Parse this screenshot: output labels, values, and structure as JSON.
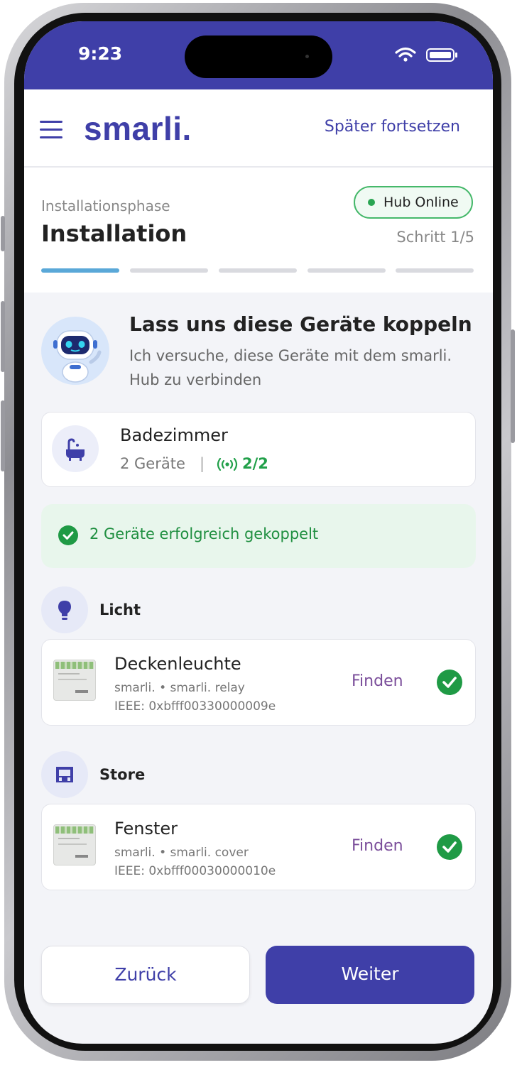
{
  "status_bar": {
    "time": "9:23"
  },
  "header": {
    "logo": "smarli.",
    "later_label": "Später fortsetzen"
  },
  "phase": {
    "label": "Installationsphase",
    "title": "Installation",
    "hub_status": "Hub Online",
    "step": "Schritt 1/5",
    "progress": {
      "current": 1,
      "total": 5
    }
  },
  "intro": {
    "title": "Lass uns diese Geräte koppeln",
    "subtitle": "Ich versuche, diese Geräte mit dem smarli. Hub zu verbinden"
  },
  "room": {
    "name": "Badezimmer",
    "devices": "2 Geräte",
    "separator": "|",
    "paired": "2/2"
  },
  "success_message": "2 Geräte erfolgreich gekoppelt",
  "categories": [
    {
      "label": "Licht",
      "icon": "lightbulb-icon",
      "device": {
        "name": "Deckenleuchte",
        "model": "smarli. • smarli. relay",
        "ieee": "IEEE: 0xbfff00330000009e",
        "action": "Finden"
      }
    },
    {
      "label": "Store",
      "icon": "blinds-icon",
      "device": {
        "name": "Fenster",
        "model": "smarli. • smarli. cover",
        "ieee": "IEEE: 0xbfff00030000010e",
        "action": "Finden"
      }
    }
  ],
  "footer": {
    "back_label": "Zurück",
    "next_label": "Weiter"
  },
  "colors": {
    "primary": "#3f3fa8",
    "success": "#1f9a45",
    "find": "#7a4d9a",
    "progress_active": "#5aa8d8"
  }
}
